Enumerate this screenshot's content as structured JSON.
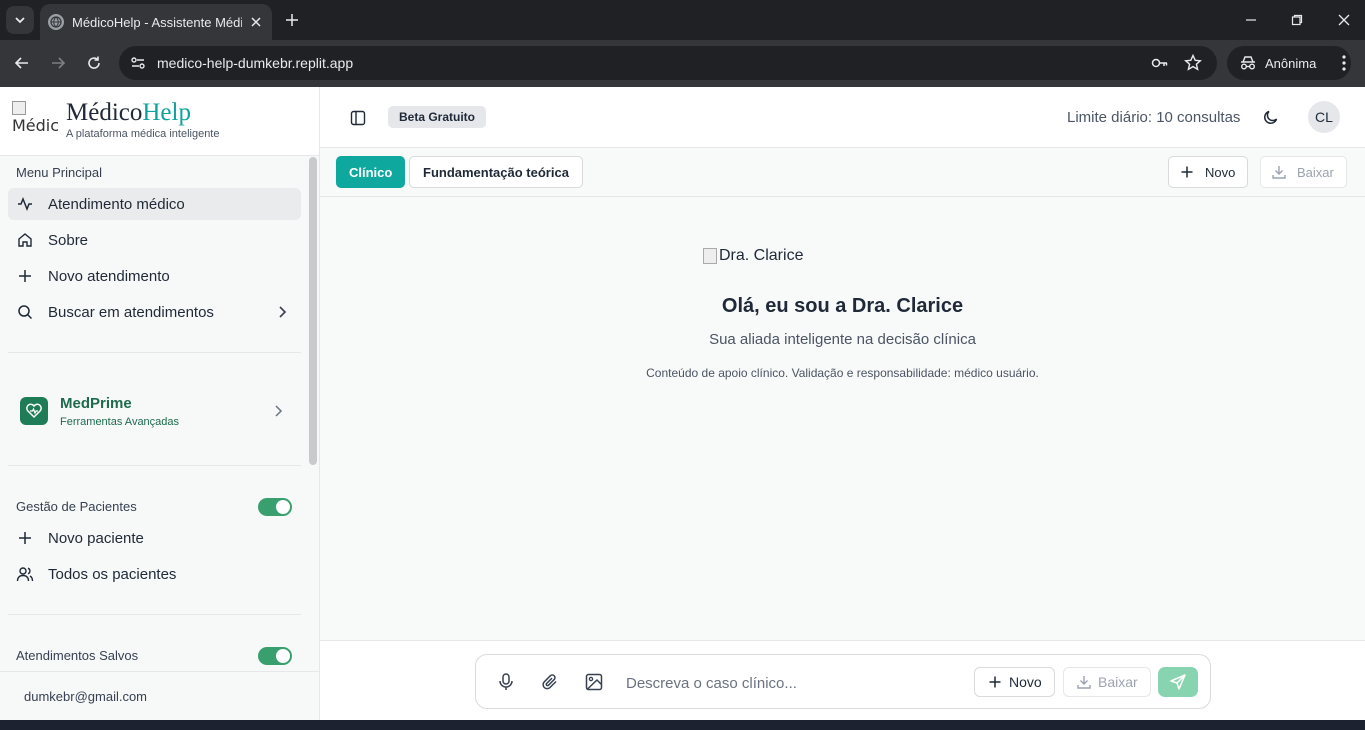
{
  "browser": {
    "tab_title": "MédicoHelp - Assistente Médico",
    "url": "medico-help-dumkebr.replit.app",
    "profile_label": "Anônima"
  },
  "brand": {
    "logo_alt": "Médic",
    "name_part1": "Médico",
    "name_part2": "Help",
    "tagline": "A plataforma médica inteligente",
    "accent_color": "#0fa3a0"
  },
  "sidebar": {
    "menu_title": "Menu Principal",
    "menu_items": [
      {
        "label": "Atendimento médico",
        "icon": "activity-icon",
        "active": true
      },
      {
        "label": "Sobre",
        "icon": "home-icon"
      },
      {
        "label": "Novo atendimento",
        "icon": "plus-icon"
      },
      {
        "label": "Buscar em atendimentos",
        "icon": "search-icon"
      }
    ],
    "medprime": {
      "name": "MedPrime",
      "subtitle": "Ferramentas Avançadas"
    },
    "patients": {
      "title": "Gestão de Pacientes",
      "toggle_on": true,
      "items": [
        {
          "label": "Novo paciente",
          "icon": "plus-icon"
        },
        {
          "label": "Todos os pacientes",
          "icon": "users-icon"
        }
      ]
    },
    "saved": {
      "title": "Atendimentos Salvos",
      "toggle_on": true
    },
    "user_email": "dumkebr@gmail.com"
  },
  "header": {
    "badge": "Beta Gratuito",
    "limit_text": "Limite diário: 10 consultas",
    "avatar_initials": "CL"
  },
  "tabs": {
    "clinical": "Clínico",
    "theory": "Fundamentação teórica",
    "new_label": "Novo",
    "download_label": "Baixar"
  },
  "welcome": {
    "image_alt": "Dra. Clarice",
    "title": "Olá, eu sou a Dra. Clarice",
    "subtitle": "Sua aliada inteligente na decisão clínica",
    "note": "Conteúdo de apoio clínico. Validação e responsabilidade: médico usuário."
  },
  "composer": {
    "placeholder": "Descreva o caso clínico...",
    "new_label": "Novo",
    "download_label": "Baixar"
  },
  "colors": {
    "primary": "#0fa89e",
    "toggle": "#3a9f6e",
    "medprime": "#1e7d57",
    "send": "#88d4b0"
  }
}
